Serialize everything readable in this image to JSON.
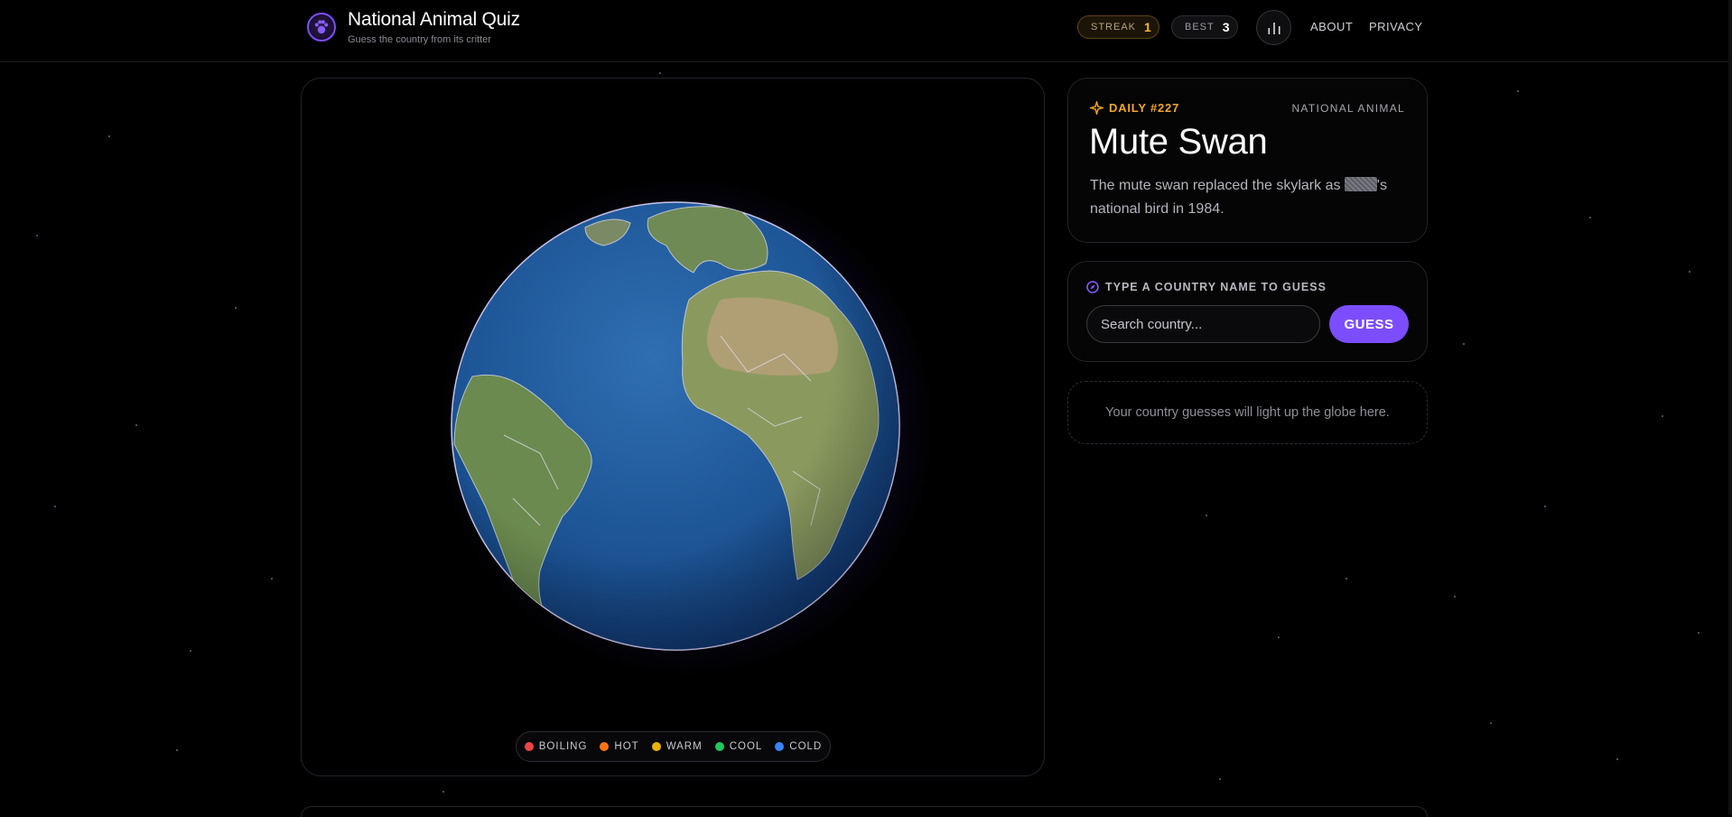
{
  "app": {
    "title": "National Animal Quiz",
    "subtitle": "Guess the country from its critter"
  },
  "header": {
    "streak_label": "STREAK",
    "streak_value": "1",
    "best_label": "BEST",
    "best_value": "3",
    "stats_icon": "bar-chart-icon",
    "nav": {
      "about": "ABOUT",
      "privacy": "PRIVACY"
    }
  },
  "legend": {
    "items": [
      {
        "label": "BOILING",
        "color": "#ef4444"
      },
      {
        "label": "HOT",
        "color": "#f97316"
      },
      {
        "label": "WARM",
        "color": "#eab308"
      },
      {
        "label": "COOL",
        "color": "#22c55e"
      },
      {
        "label": "COLD",
        "color": "#3b82f6"
      }
    ]
  },
  "puzzle": {
    "daily_label": "DAILY #227",
    "category": "NATIONAL ANIMAL",
    "animal": "Mute Swan",
    "fact_before": "The mute swan replaced the skylark as ",
    "fact_after": "'s national bird in 1984."
  },
  "guess": {
    "label": "TYPE A COUNTRY NAME TO GUESS",
    "placeholder": "Search country...",
    "value": "",
    "button": "GUESS"
  },
  "guesses_empty": "Your country guesses will light up the globe here.",
  "colors": {
    "accent": "#7c4dff",
    "streak": "#f5b83a",
    "daily": "#f5a623"
  }
}
